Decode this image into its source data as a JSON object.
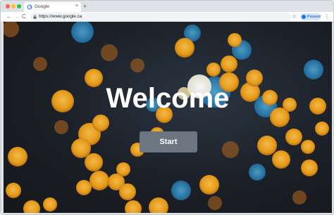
{
  "browser": {
    "tab_title": "Google",
    "tab_close": "×",
    "new_tab": "+",
    "url": "https://www.google.ca",
    "back_icon": "←",
    "forward_icon": "→",
    "reload_icon": "C",
    "star_icon": "☆",
    "profile_label": "Paused",
    "menu_icon": "⋮"
  },
  "page": {
    "heading": "Welcome",
    "start_button": "Start",
    "background": "bokeh-lights"
  },
  "colors": {
    "button_bg": "#6b7680",
    "heading": "#ffffff",
    "bokeh_orange": "#f0a21a",
    "bokeh_blue": "#2aa3e0"
  }
}
